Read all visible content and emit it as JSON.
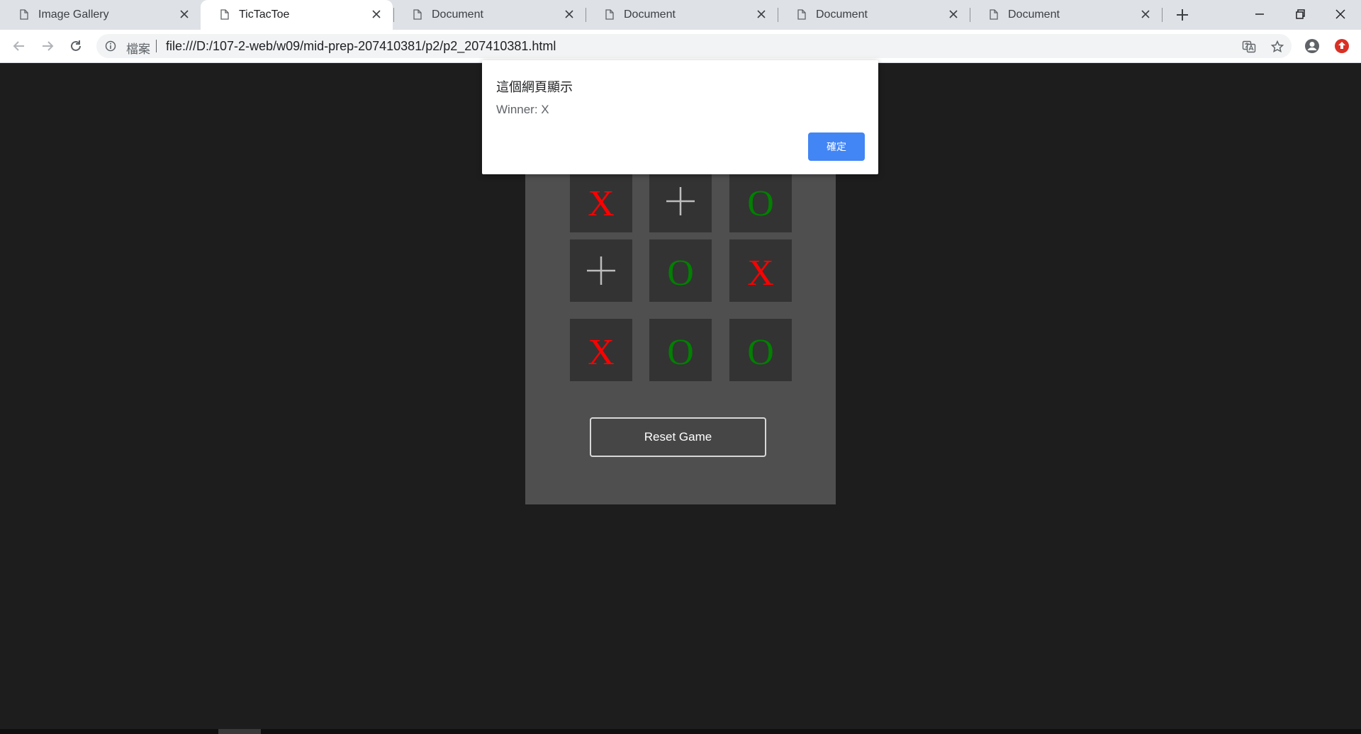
{
  "browser": {
    "tabs": [
      {
        "title": "Image Gallery"
      },
      {
        "title": "TicTacToe"
      },
      {
        "title": "Document"
      },
      {
        "title": "Document"
      },
      {
        "title": "Document"
      },
      {
        "title": "Document"
      }
    ],
    "active_tab_index": 1,
    "omnibox": {
      "security_label": "檔案",
      "url": "file:///D:/107-2-web/w09/mid-prep-207410381/p2/p2_207410381.html"
    }
  },
  "game": {
    "board": [
      [
        "X",
        "",
        "O"
      ],
      [
        "",
        "O",
        "X"
      ],
      [
        "X",
        "O",
        "O"
      ]
    ],
    "reset_label": "Reset Game",
    "colors": {
      "x": "#ff0000",
      "o": "#008000",
      "empty_plus": "#bdbdbd"
    }
  },
  "dialog": {
    "title": "這個網頁顯示",
    "message": "Winner: X",
    "ok_label": "確定",
    "ok_color": "#4285f4"
  }
}
